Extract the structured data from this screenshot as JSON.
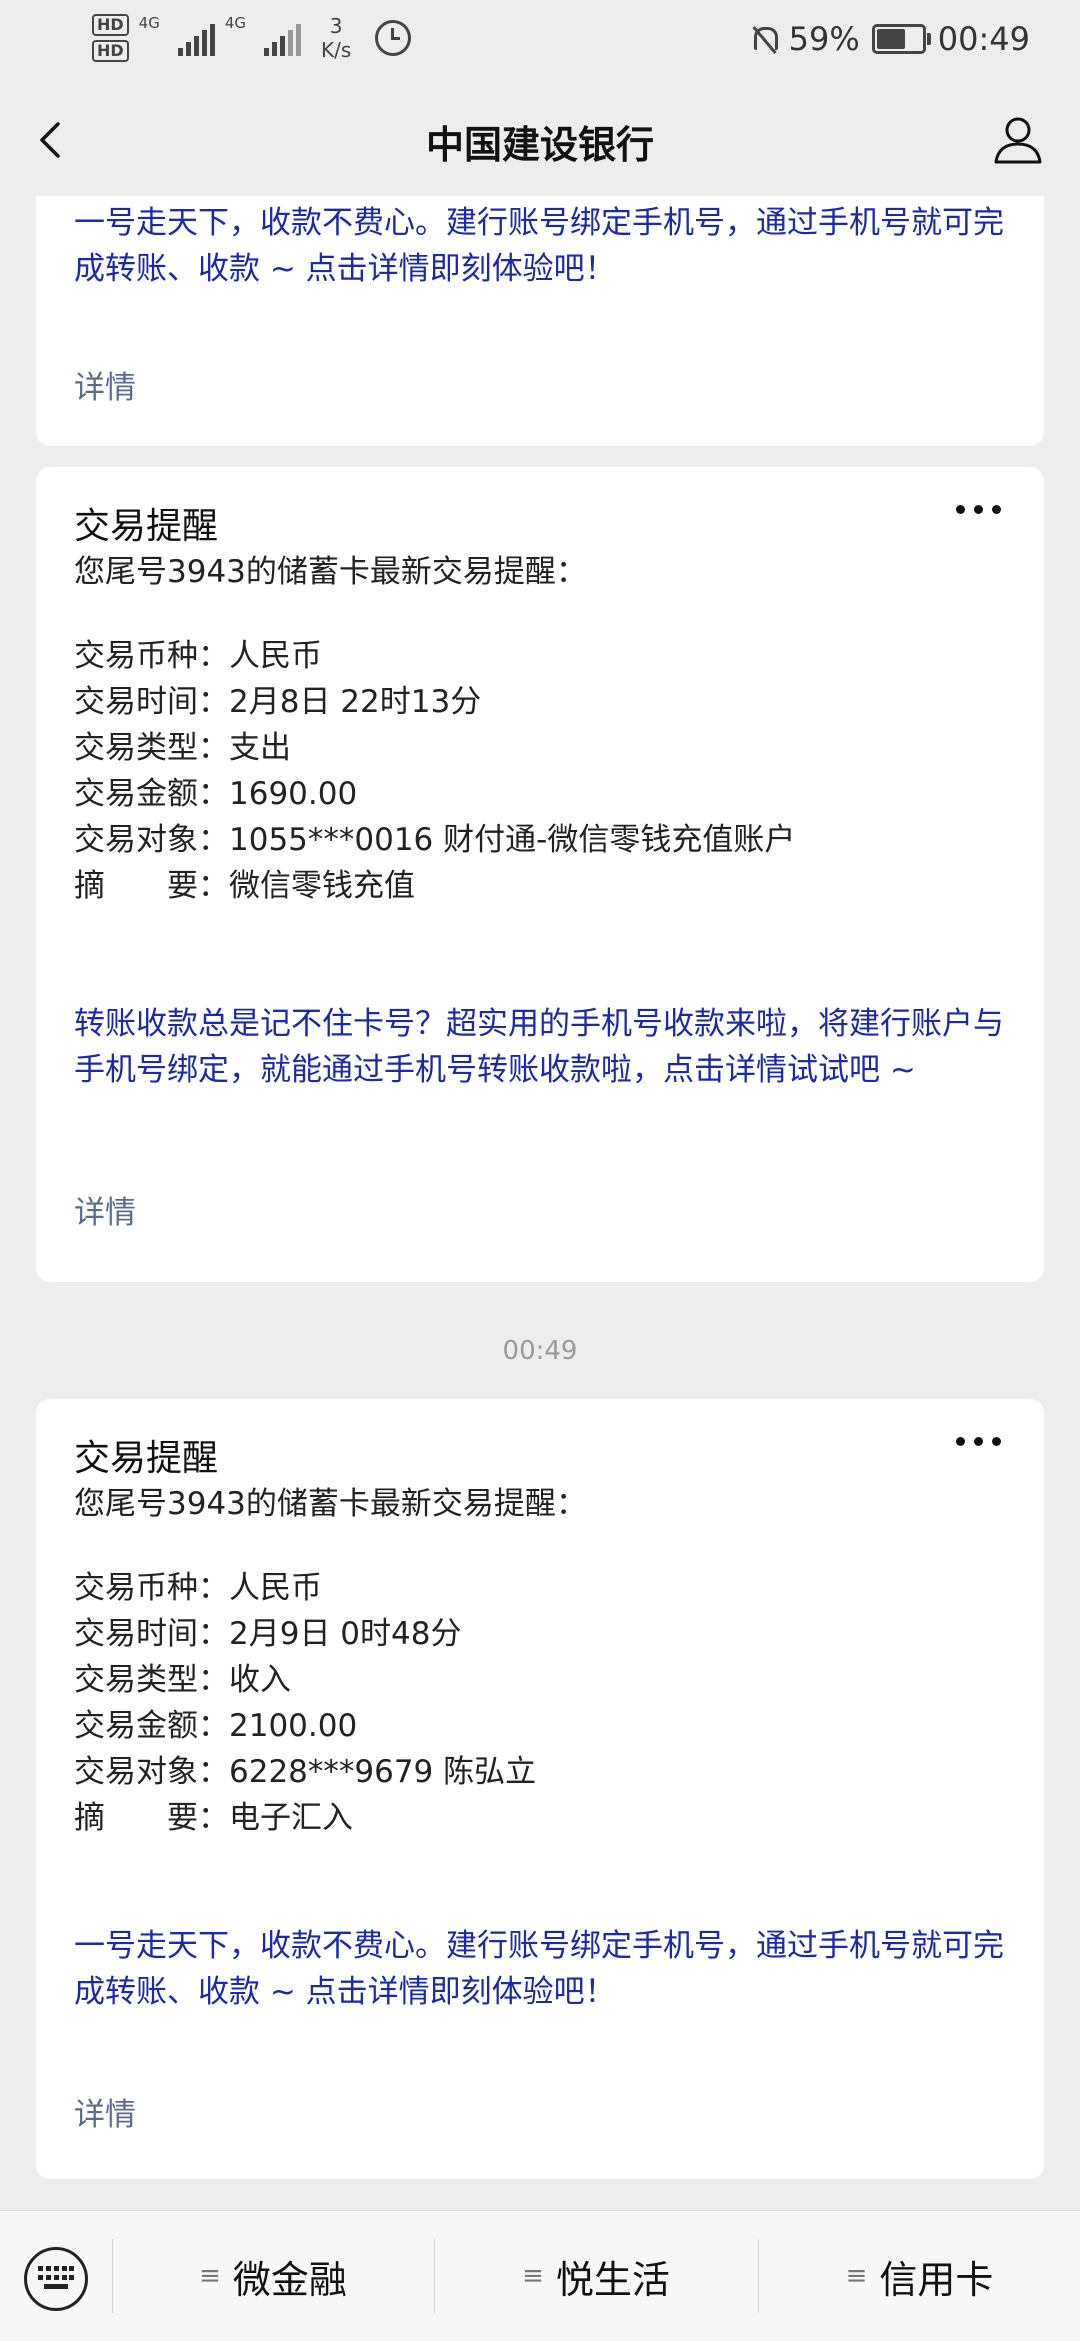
{
  "status_bar": {
    "network": "4G",
    "net_speed_value": "3",
    "net_speed_unit": "K/s",
    "battery": "59%",
    "battery_level": 0.59,
    "time": "00:49"
  },
  "nav": {
    "title": "中国建设银行"
  },
  "top_card": {
    "promo": "一号走天下，收款不费心。建行账号绑定手机号，通过手机号就可完成转账、收款 ~ 点击详情即刻体验吧！",
    "detail": "详情"
  },
  "card1": {
    "title": "交易提醒",
    "intro": "您尾号3943的储蓄卡最新交易提醒：",
    "fields": [
      {
        "label": "交易币种：",
        "value": "人民币"
      },
      {
        "label": "交易时间：",
        "value": "2月8日 22时13分"
      },
      {
        "label": "交易类型：",
        "value": "支出"
      },
      {
        "label": "交易金额：",
        "value": "1690.00"
      },
      {
        "label": "交易对象：",
        "value": "1055***0016 财付通-微信零钱充值账户"
      },
      {
        "label": "摘　　要：",
        "value": "微信零钱充值"
      }
    ],
    "promo": "转账收款总是记不住卡号？超实用的手机号收款来啦，将建行账户与手机号绑定，就能通过手机号转账收款啦，点击详情试试吧 ~",
    "detail": "详情"
  },
  "timestamp": "00:49",
  "card2": {
    "title": "交易提醒",
    "intro": "您尾号3943的储蓄卡最新交易提醒：",
    "fields": [
      {
        "label": "交易币种：",
        "value": "人民币"
      },
      {
        "label": "交易时间：",
        "value": "2月9日 0时48分"
      },
      {
        "label": "交易类型：",
        "value": "收入"
      },
      {
        "label": "交易金额：",
        "value": "2100.00"
      },
      {
        "label": "交易对象：",
        "value": "6228***9679 陈弘立"
      },
      {
        "label": "摘　　要：",
        "value": "电子汇入"
      }
    ],
    "promo": "一号走天下，收款不费心。建行账号绑定手机号，通过手机号就可完成转账、收款 ~ 点击详情即刻体验吧！",
    "detail": "详情"
  },
  "bottom_menu": {
    "items": [
      "微金融",
      "悦生活",
      "信用卡"
    ],
    "menu_icon": "≡"
  }
}
